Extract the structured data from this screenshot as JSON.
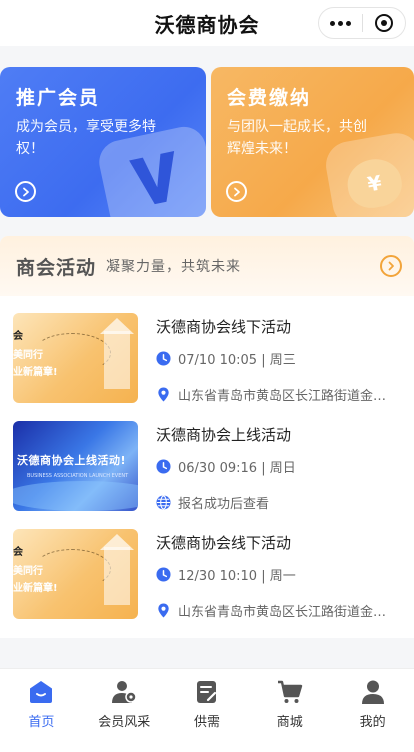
{
  "header": {
    "title": "沃德商协会",
    "more_icon": "more-dots-icon",
    "close_icon": "target-circle-icon"
  },
  "promos": [
    {
      "title": "推广会员",
      "desc": "成为会员，享受更多特权！",
      "color": "#3d6cf0"
    },
    {
      "title": "会费缴纳",
      "desc": "与团队一起成长，共创辉煌未来！",
      "color": "#f6a94a"
    }
  ],
  "section": {
    "title": "商会活动",
    "subtitle": "凝聚力量，共筑未来",
    "accent": "#f2a43a"
  },
  "activities": [
    {
      "title": "沃德商协会线下活动",
      "time": "07/10 10:05 | 周三",
      "location": "山东省青岛市黄岛区长江路街道金…",
      "thumb_lines": [
        "会",
        "美同行",
        "业新篇章!"
      ]
    },
    {
      "title": "沃德商协会上线活动",
      "time": "06/30 09:16 | 周日",
      "location": "报名成功后查看",
      "thumb_lines": [
        "沃德商协会上线活动!",
        "BUSINESS ASSOCIATION LAUNCH EVENT"
      ]
    },
    {
      "title": "沃德商协会线下活动",
      "time": "12/30 10:10 | 周一",
      "location": "山东省青岛市黄岛区长江路街道金…",
      "thumb_lines": [
        "会",
        "美同行",
        "业新篇章!"
      ]
    }
  ],
  "nav": [
    {
      "label": "首页",
      "icon": "home-icon",
      "active": true
    },
    {
      "label": "会员风采",
      "icon": "member-icon",
      "active": false
    },
    {
      "label": "供需",
      "icon": "supply-demand-icon",
      "active": false
    },
    {
      "label": "商城",
      "icon": "cart-icon",
      "active": false
    },
    {
      "label": "我的",
      "icon": "user-icon",
      "active": false
    }
  ],
  "colors": {
    "primary": "#3a6bf0",
    "nav_icon": "#555555"
  }
}
